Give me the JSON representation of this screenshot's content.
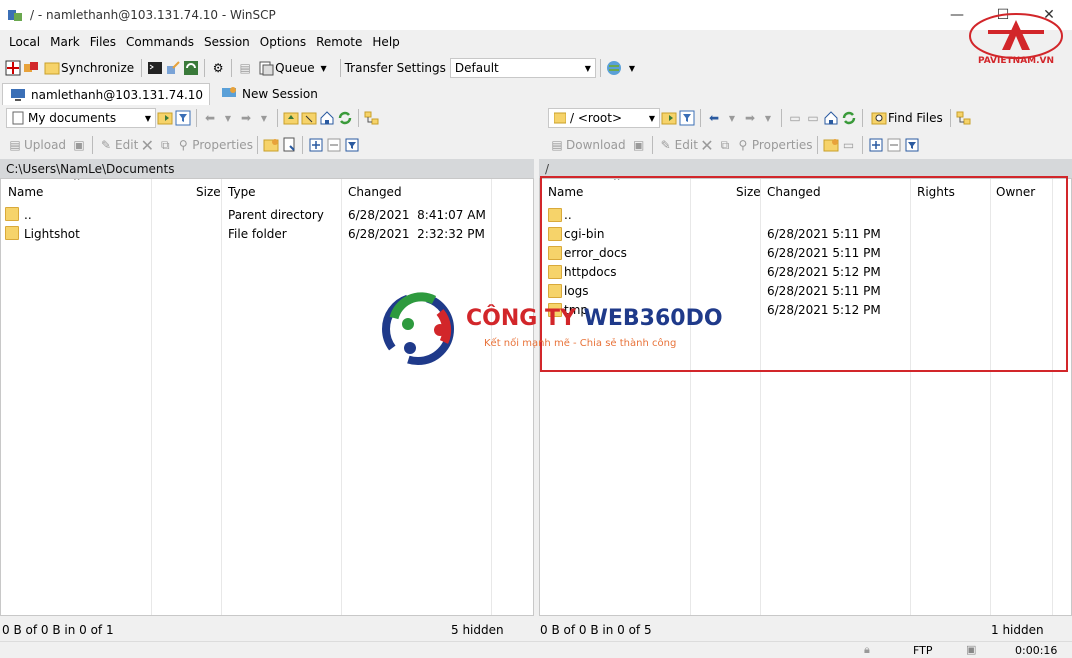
{
  "window": {
    "title": "/ - namlethanh@103.131.74.10 - WinSCP"
  },
  "menu": [
    "Local",
    "Mark",
    "Files",
    "Commands",
    "Session",
    "Options",
    "Remote",
    "Help"
  ],
  "toolbar": {
    "synchronize": "Synchronize",
    "queue": "Queue",
    "transfer_settings": "Transfer Settings",
    "transfer_preset": "Default"
  },
  "tabs": {
    "session": "namlethanh@103.131.74.10",
    "new_session": "New Session"
  },
  "left": {
    "location": "My documents",
    "path": "C:\\Users\\NamLe\\Documents",
    "actions": {
      "upload": "Upload",
      "edit": "Edit",
      "properties": "Properties"
    },
    "columns": {
      "name": "Name",
      "size": "Size",
      "type": "Type",
      "changed": "Changed"
    },
    "files": [
      {
        "name": "..",
        "type": "Parent directory",
        "changed": "6/28/2021  8:41:07 AM",
        "parent": true
      },
      {
        "name": "Lightshot",
        "type": "File folder",
        "changed": "6/28/2021  2:32:32 PM"
      }
    ],
    "status": "0 B of 0 B in 0 of 1",
    "hidden": "5 hidden"
  },
  "right": {
    "location": "/ <root>",
    "path": "/",
    "actions": {
      "download": "Download",
      "edit": "Edit",
      "properties": "Properties",
      "find_files": "Find Files"
    },
    "columns": {
      "name": "Name",
      "size": "Size",
      "changed": "Changed",
      "rights": "Rights",
      "owner": "Owner"
    },
    "files": [
      {
        "name": "..",
        "changed": "",
        "parent": true
      },
      {
        "name": "cgi-bin",
        "changed": "6/28/2021 5:11 PM"
      },
      {
        "name": "error_docs",
        "changed": "6/28/2021 5:11 PM"
      },
      {
        "name": "httpdocs",
        "changed": "6/28/2021 5:12 PM"
      },
      {
        "name": "logs",
        "changed": "6/28/2021 5:11 PM"
      },
      {
        "name": "tmp",
        "changed": "6/28/2021 5:12 PM"
      }
    ],
    "status": "0 B of 0 B in 0 of 5",
    "hidden": "1 hidden"
  },
  "bottom": {
    "protocol": "FTP",
    "timer": "0:00:16"
  },
  "watermark": {
    "title_a": "CÔNG TY",
    "title_b": "WEB360DO",
    "slogan": "Kết nối mạnh mẽ - Chia sẻ thành công"
  },
  "logo_tr": {
    "text": "PAVIETNAM.VN"
  },
  "colors": {
    "accent_red": "#d2262a",
    "brand_blue": "#1f3a8a",
    "folder": "#f6d36a"
  }
}
